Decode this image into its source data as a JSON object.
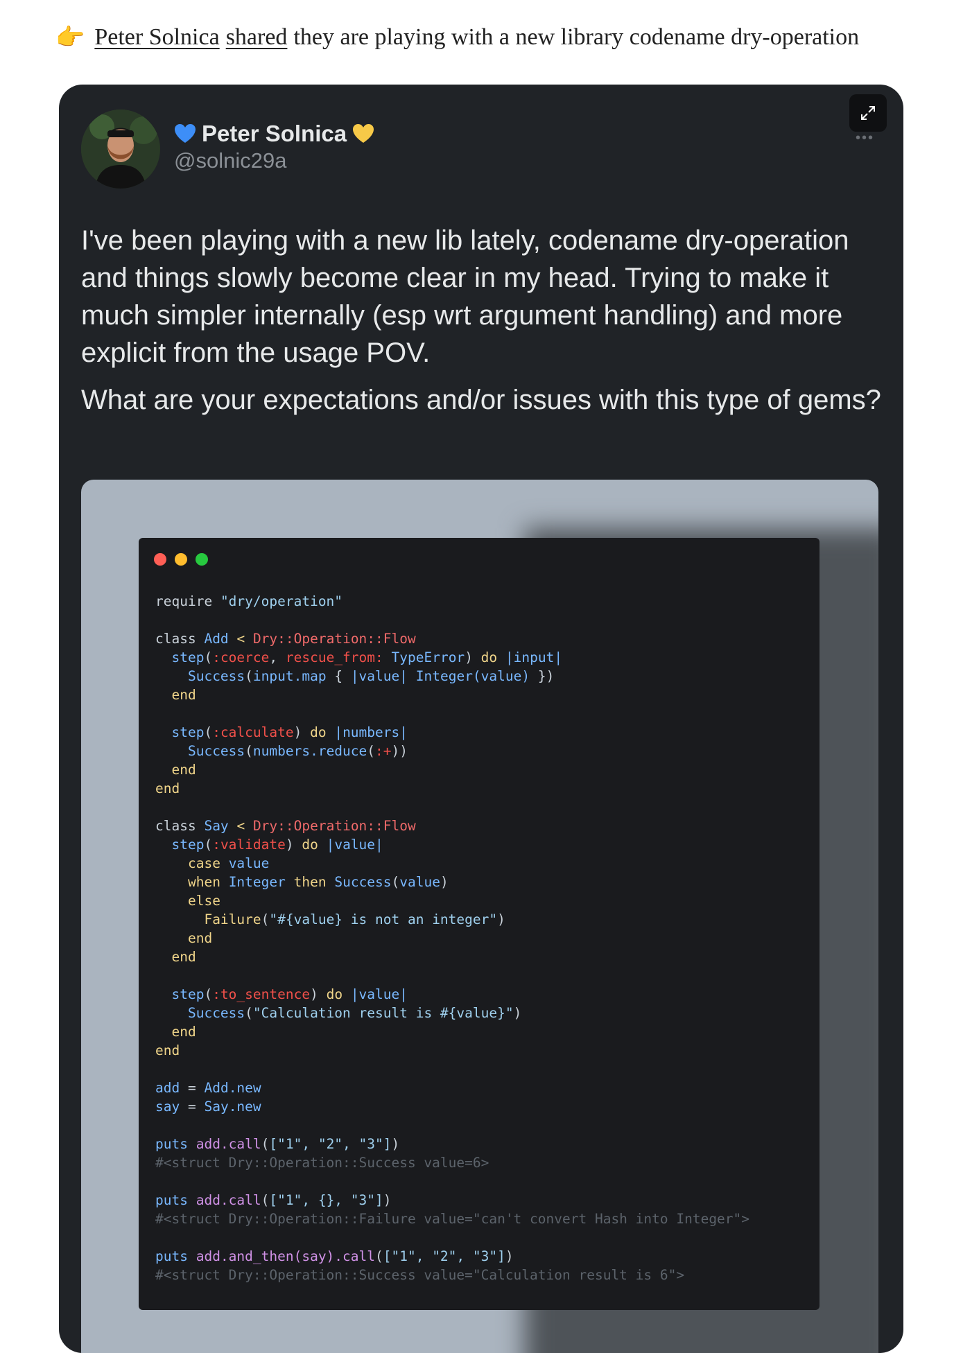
{
  "intro": {
    "pointer": "👉",
    "author_link": "Peter Solnica",
    "shared_link": "shared",
    "rest": "they are playing with a new library codename dry-operation"
  },
  "tweet": {
    "author_name": "Peter Solnica",
    "handle": "@solnic29a",
    "paragraph1": "I've been playing with a new lib lately, codename dry-operation and things slowly become clear in my head. Trying to make it much simpler internally (esp wrt argument handling) and more explicit from the usage POV.",
    "paragraph2": "What are your expectations and/or issues with this type of gems?",
    "more": "•••",
    "icons": [
      "expand-icon",
      "blue-heart-icon",
      "yellow-heart-icon"
    ]
  },
  "code": {
    "window_dots": [
      "#ff5f56",
      "#ffbd2e",
      "#27c93f"
    ],
    "l1": "require",
    "l1s": "\"dry/operation\"",
    "cls_kw": "class",
    "add": "Add",
    "lt": "<",
    "flow": "Dry::Operation::Flow",
    "step": "step",
    "coerce": ":coerce",
    "rescue_from": "rescue_from:",
    "typeerror": "TypeError",
    "do_kw": "do",
    "input_arg": "|input|",
    "success": "Success",
    "input_map": "input.map",
    "value_arg": "|value|",
    "integer_call": "Integer(value)",
    "end_kw": "end",
    "calculate": ":calculate",
    "numbers_arg": "|numbers|",
    "numbers_reduce": "numbers.reduce",
    "plus_sym": ":+",
    "say": "Say",
    "validate": ":validate",
    "case_kw": "case",
    "value": "value",
    "when_kw": "when",
    "integer": "Integer",
    "then_kw": "then",
    "else_kw": "else",
    "failure": "Failure",
    "failure_msg": "\"#{value} is not an integer\"",
    "to_sentence": ":to_sentence",
    "sentence_msg": "\"Calculation result is #{value}\"",
    "add_var": "add",
    "say_var": "say",
    "add_new": "Add.new",
    "say_new": "Say.new",
    "puts_kw": "puts",
    "call1": "add.call",
    "args1": "[\"1\", \"2\", \"3\"]",
    "comment1": "#<struct Dry::Operation::Success value=6>",
    "args2": "[\"1\", {}, \"3\"]",
    "comment2": "#<struct Dry::Operation::Failure value=\"can't convert Hash into Integer\">",
    "call3": "add.and_then(say).call",
    "comment3": "#<struct Dry::Operation::Success value=\"Calculation result is 6\">"
  }
}
